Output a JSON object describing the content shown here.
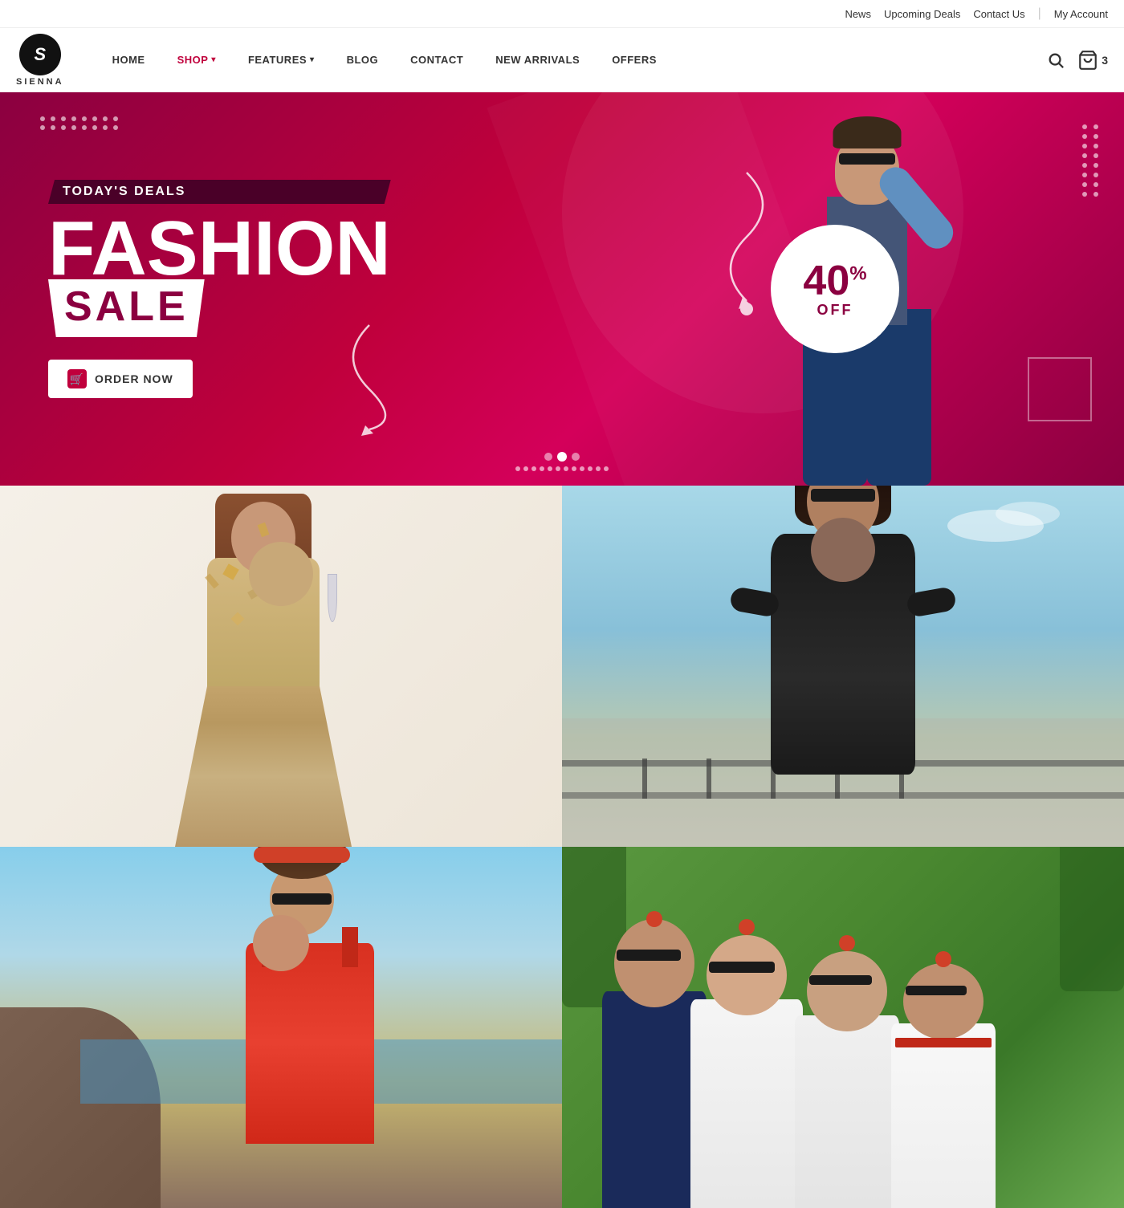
{
  "topbar": {
    "news": "News",
    "upcoming_deals": "Upcoming Deals",
    "contact_us": "Contact Us",
    "my_account": "My Account"
  },
  "nav": {
    "logo_letter": "S",
    "logo_name": "SIENNA",
    "home": "HOME",
    "shop": "SHOP",
    "features": "FEATURES",
    "blog": "BLOG",
    "contact": "CONTACT",
    "new_arrivals": "NEW ARRIVALS",
    "offers": "OFFERS",
    "cart_count": "3"
  },
  "hero": {
    "today_deals": "TODAY'S DEALS",
    "fashion": "FASHION",
    "sale": "SALE",
    "discount_percent": "40",
    "discount_symbol": "%",
    "discount_off": "OFF",
    "order_btn": "ORDER NOW",
    "nav_dots": [
      "",
      "",
      "",
      "",
      "",
      "",
      "",
      "",
      "",
      "",
      "",
      "",
      "",
      "",
      "",
      "",
      "",
      "",
      "",
      "",
      "",
      "",
      "",
      ""
    ]
  },
  "grid": {
    "image1_alt": "Woman in gold sparkly dress",
    "image2_alt": "Woman in black dress outdoors",
    "image3_alt": "Woman at beach in red outfit",
    "image4_alt": "Group of women in summer outfits"
  }
}
